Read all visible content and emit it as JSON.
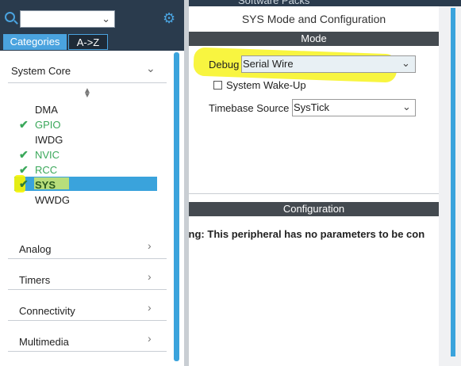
{
  "header": {
    "partial_title": "Software Packs",
    "search_placeholder": ""
  },
  "tabs": [
    {
      "label": "Categories",
      "active": true
    },
    {
      "label": "A->Z",
      "active": false
    }
  ],
  "system_core": {
    "label": "System Core",
    "items": [
      {
        "label": "DMA",
        "checked": false
      },
      {
        "label": "GPIO",
        "checked": true
      },
      {
        "label": "IWDG",
        "checked": false
      },
      {
        "label": "NVIC",
        "checked": true
      },
      {
        "label": "RCC",
        "checked": true
      },
      {
        "label": "SYS",
        "checked": true,
        "selected": true
      },
      {
        "label": "WWDG",
        "checked": false
      }
    ]
  },
  "categories": [
    {
      "label": "Analog"
    },
    {
      "label": "Timers"
    },
    {
      "label": "Connectivity"
    },
    {
      "label": "Multimedia"
    }
  ],
  "config_panel": {
    "title": "SYS Mode and Configuration",
    "mode_header": "Mode",
    "debug_label": "Debug",
    "debug_value": "Serial Wire",
    "wakeup_label": "System Wake-Up",
    "wakeup_checked": false,
    "timebase_label": "Timebase Source",
    "timebase_value": "SysTick",
    "configuration_header": "Configuration",
    "warning": "ning: This peripheral has no parameters to be con"
  },
  "colors": {
    "accent": "#3aa3dc",
    "check_green": "#3aa85a",
    "dark_header": "#2a3b4d",
    "section_bar": "#444a50",
    "annotation_yellow": "#f5f200"
  },
  "icons": {
    "search": "search-icon",
    "gear": "gear-icon",
    "chevron_down": "chevron-down-icon",
    "chevron_right": "chevron-right-icon",
    "check": "check-icon",
    "sort": "sort-icon"
  }
}
